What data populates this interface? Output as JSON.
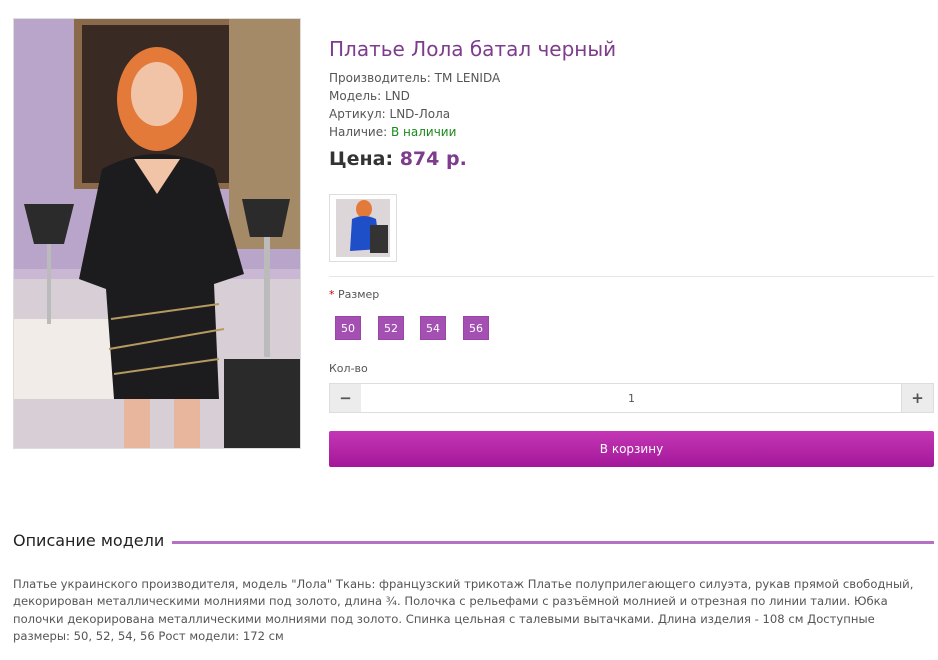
{
  "product": {
    "title": "Платье Лола батал черный",
    "manufacturer_label": "Производитель:",
    "manufacturer": "TM LENIDA",
    "model_label": "Модель:",
    "model": "LND",
    "sku_label": "Артикул:",
    "sku": "LND-Лола",
    "stock_label": "Наличие:",
    "stock": "В наличии",
    "price_label": "Цена:",
    "price": "874 р."
  },
  "options": {
    "required_mark": "*",
    "size_label": "Размер",
    "sizes": [
      "50",
      "52",
      "54",
      "56"
    ],
    "qty_label": "Кол-во",
    "qty_value": "1",
    "minus": "−",
    "plus": "+"
  },
  "cart": {
    "button_label": "В корзину"
  },
  "description": {
    "heading": "Описание модели",
    "text": "Платье украинского производителя, модель \"Лола\" Ткань: французский трикотаж Платье полуприлегающего силуэта, рукав прямой свободный, декорирован металлическими молниями под золото, длина ¾. Полочка с рельефами с разъёмной молнией и отрезная по линии талии. Юбка полочки декорирована металлическими молниями под золото. Спинка цельная с талевыми вытачками. Длина изделия - 108 см Доступные размеры: 50, 52, 54, 56 Рост модели: 172 см"
  },
  "colors": {
    "accent": "#7d3c8c",
    "size_bg": "#a44fb2",
    "cart_bg": "#b527a8",
    "stock": "#1a8a1a"
  }
}
